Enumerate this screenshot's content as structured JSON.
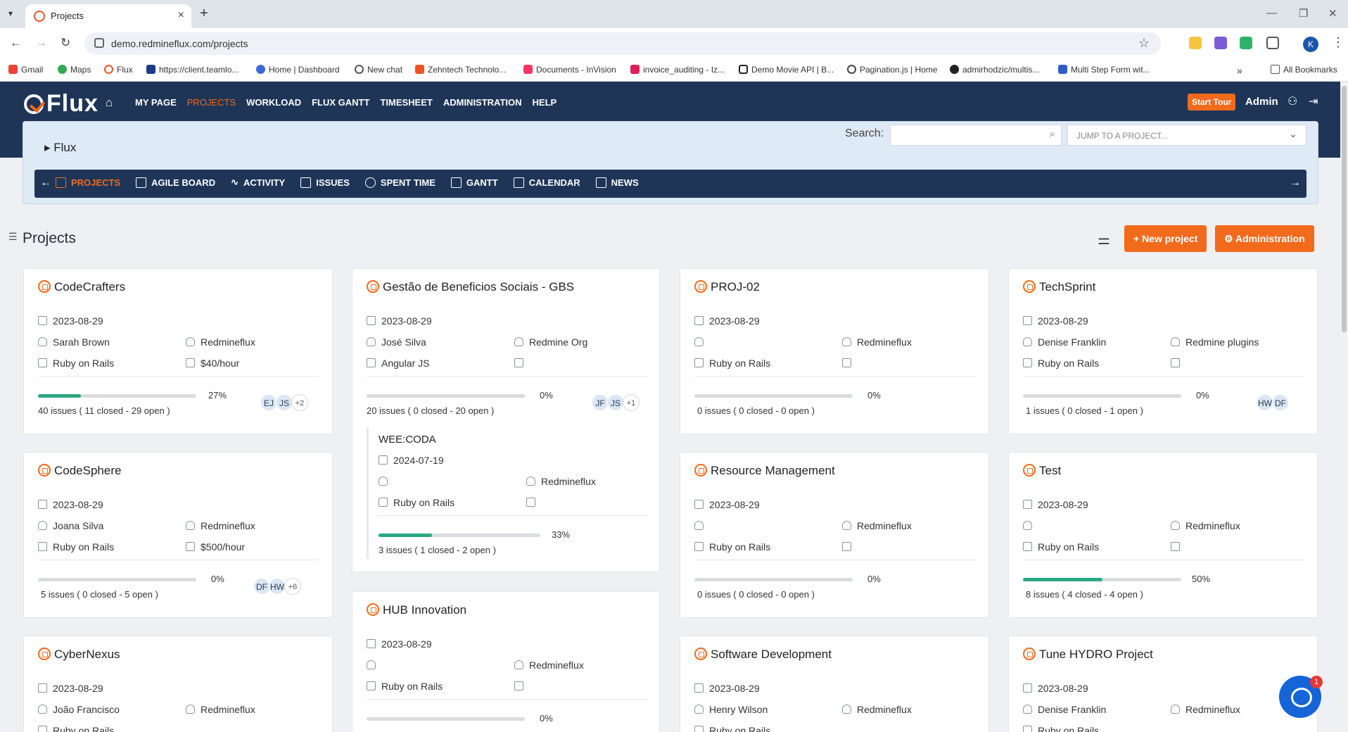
{
  "browser": {
    "tab_title": "Projects",
    "url": "demo.redmineflux.com/projects",
    "profile_initial": "K",
    "bookmarks": [
      "Gmail",
      "Maps",
      "Flux",
      "https://client.teamlo...",
      "Home | Dashboard",
      "New chat",
      "Zehntech Technolo...",
      "Documents - InVision",
      "invoice_auditing - Iz...",
      "Demo Movie API | B...",
      "Pagination.js | Home",
      "admirhodzic/multis...",
      "Multi Step Form wit..."
    ],
    "all_bookmarks": "All Bookmarks"
  },
  "header": {
    "logo": "Flux",
    "nav": [
      "MY PAGE",
      "PROJECTS",
      "WORKLOAD",
      "FLUX GANTT",
      "TIMESHEET",
      "ADMINISTRATION",
      "HELP"
    ],
    "active_nav": "PROJECTS",
    "start_tour": "Start Tour",
    "user": "Admin"
  },
  "project_panel": {
    "name": "Flux",
    "search_label": "Search:",
    "search_value": "",
    "jump_placeholder": "JUMP TO A PROJECT...",
    "menu": [
      "PROJECTS",
      "AGILE BOARD",
      "ACTIVITY",
      "ISSUES",
      "SPENT TIME",
      "GANTT",
      "CALENDAR",
      "NEWS"
    ]
  },
  "page": {
    "title": "Projects",
    "new_project": "+ New project",
    "administration": "Administration"
  },
  "projects": [
    {
      "name": "CodeCrafters",
      "date": "2023-08-29",
      "manager": "Sarah Brown",
      "org": "Redmineflux",
      "tech": "Ruby on Rails",
      "rate": "$40/hour",
      "progress": 27,
      "progress_label": "27%",
      "issues": "40 issues ( 11 closed - 29 open )",
      "avatars": [
        "EJ",
        "JS"
      ],
      "more": "+2"
    },
    {
      "name": "Gestão de Beneficios Sociais - GBS",
      "date": "2023-08-29",
      "manager": "José Silva",
      "org": "Redmine Org",
      "tech": "Angular JS",
      "rate": "",
      "progress": 0,
      "progress_label": "0%",
      "issues": "20 issues ( 0 closed - 20 open )",
      "avatars": [
        "JF",
        "JS"
      ],
      "more": "+1"
    },
    {
      "name": "PROJ-02",
      "date": "2023-08-29",
      "manager": "",
      "org": "Redmineflux",
      "tech": "Ruby on Rails",
      "rate": "",
      "progress": 0,
      "progress_label": "0%",
      "issues": "0 issues ( 0 closed - 0 open )"
    },
    {
      "name": "TechSprint",
      "date": "2023-08-29",
      "manager": "Denise Franklin",
      "org": "Redmine plugins",
      "tech": "Ruby on Rails",
      "rate": "",
      "progress": 0,
      "progress_label": "0%",
      "issues": "1 issues ( 0 closed - 1 open )",
      "avatars": [
        "HW",
        "DF"
      ]
    },
    {
      "name": "CodeSphere",
      "date": "2023-08-29",
      "manager": "Joana Silva",
      "org": "Redmineflux",
      "tech": "Ruby on Rails",
      "rate": "$500/hour",
      "progress": 0,
      "progress_label": "0%",
      "issues": "5 issues ( 0 closed - 5 open )",
      "avatars": [
        "DF",
        "HW"
      ],
      "more": "+6"
    },
    {
      "name": "Resource Management",
      "date": "2023-08-29",
      "manager": "",
      "org": "Redmineflux",
      "tech": "Ruby on Rails",
      "rate": "",
      "progress": 0,
      "progress_label": "0%",
      "issues": "0 issues ( 0 closed - 0 open )"
    },
    {
      "name": "Test",
      "date": "2023-08-29",
      "manager": "",
      "org": "Redmineflux",
      "tech": "Ruby on Rails",
      "rate": "",
      "progress": 50,
      "progress_label": "50%",
      "issues": "8 issues ( 4 closed - 4 open )"
    },
    {
      "name": "CyberNexus",
      "date": "2023-08-29",
      "manager": "João Francisco",
      "org": "Redmineflux",
      "tech": "Ruby on Rails"
    },
    {
      "name": "HUB Innovation",
      "date": "2023-08-29",
      "manager": "",
      "org": "Redmineflux",
      "tech": "Ruby on Rails",
      "progress": 0,
      "progress_label": "0%"
    },
    {
      "name": "Software Development",
      "date": "2023-08-29",
      "manager": "Henry Wilson",
      "org": "Redmineflux",
      "tech": "Ruby on Rails"
    },
    {
      "name": "Tune HYDRO Project",
      "date": "2023-08-29",
      "manager": "Denise Franklin",
      "org": "Redmineflux",
      "tech": "Ruby on Rails"
    }
  ],
  "subproject": {
    "name": "WEE:CODA",
    "date": "2024-07-19",
    "manager": "",
    "org": "Redmineflux",
    "tech": "Ruby on Rails",
    "progress": 33,
    "progress_label": "33%",
    "issues": "3 issues ( 1 closed - 2 open )"
  },
  "chat": {
    "badge": "1"
  },
  "colors": {
    "header": "#1e3558",
    "accent": "#f26a1b",
    "progress": "#2aa883"
  }
}
